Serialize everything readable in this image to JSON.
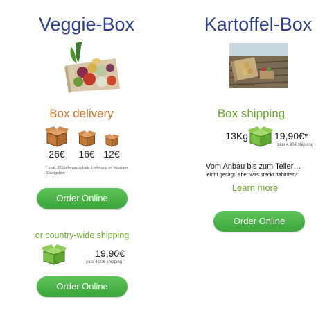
{
  "veggie": {
    "title": "Veggie-Box",
    "delivery_heading": "Box delivery",
    "prices": [
      "26€",
      "16€",
      "12€"
    ],
    "note": "* zzgl. 3€ Lieferpauschale, Lieferung im leipziger Stadtgebiet",
    "order_label": "Order Online",
    "shipping_heading": "or country-wide shipping",
    "shipping_price": "19,90€",
    "shipping_sub": "plus 4,90€ shipping",
    "order_label_2": "Order Online"
  },
  "kartoffel": {
    "title": "Kartoffel-Box",
    "shipping_heading": "Box shipping",
    "weight": "13Kg",
    "price": "19,90€*",
    "price_sub": "plus 4,90€ shipping",
    "tagline": "Vom Anbau bis zum Teller…",
    "tagline_sub": "leicht gesagt, aber was steckt dahinter?",
    "learn_more": "Learn more",
    "order_label": "Order Online"
  },
  "colors": {
    "title": "#2c3f8f",
    "orange_box": "#c9803f",
    "green_box": "#7ac143",
    "button": "#4cb848"
  }
}
